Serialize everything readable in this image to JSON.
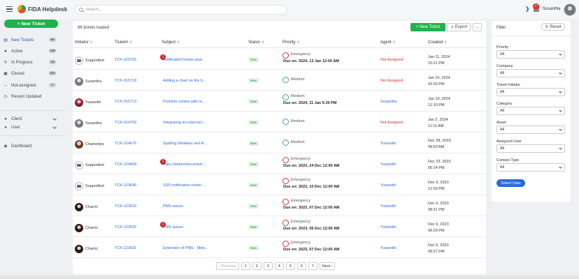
{
  "app": {
    "title": "FIDA Helpdesk"
  },
  "search": {
    "placeholder": "Search..."
  },
  "header": {
    "notification_count": "17",
    "user_name": "Susantha"
  },
  "sidebar": {
    "new_ticket_label": "+ New Ticket",
    "items": [
      {
        "label": "New Tickets",
        "count": "66",
        "icon": "inbox-icon"
      },
      {
        "label": "Active",
        "count": "109",
        "icon": "star-icon"
      },
      {
        "label": "In Progress",
        "count": "43",
        "icon": "refresh-icon"
      },
      {
        "label": "Closed",
        "count": "344",
        "icon": "folder-icon"
      },
      {
        "label": "Not-assigned",
        "count": "7",
        "icon": "minus-icon"
      },
      {
        "label": "Recent Updated",
        "count": "",
        "icon": "clock-icon"
      }
    ],
    "groups": [
      {
        "label": "Client",
        "icon": "person-icon"
      },
      {
        "label": "User",
        "icon": "person-icon"
      }
    ],
    "dashboard_label": "Dashboard"
  },
  "main": {
    "loaded_text": "66 tickets loaded",
    "new_ticket_btn": "+ New Ticket",
    "export_btn": "Export",
    "more_btn": "...",
    "columns": [
      "Initiator",
      "Ticket#",
      "Subject",
      "Status",
      "Priority",
      "Agent",
      "Created"
    ],
    "rows": [
      {
        "initiator": "Supportbot",
        "avatar": "bot",
        "ticket": "TCK-015755",
        "subject": "NotificationCenter.aspx",
        "badge": "1",
        "status": "New",
        "priority": "Emergency",
        "due": "Due on: 2024, 13 Jan 12:00 AM",
        "agent": "Not Assigned",
        "created_date": "Jan 11, 2024",
        "created_time": "10:21 PM"
      },
      {
        "initiator": "Susantha",
        "avatar": "grey",
        "ticket": "TCK-015718",
        "subject": "Adding a chart on the h...",
        "badge": "",
        "status": "New",
        "priority": "Medium",
        "due": "",
        "agent": "Not Assigned",
        "created_date": "Jan 10, 2024",
        "created_time": "03:20 PM"
      },
      {
        "initiator": "Yuwanthi",
        "avatar": "woman2",
        "ticket": "TCK-015713",
        "subject": "Problem comes with re...",
        "badge": "",
        "status": "New",
        "priority": "Medium",
        "due": "Due on: 2024, 11 Jan 5:30 PM",
        "agent": "Susantha",
        "created_date": "Jan 10, 2024",
        "created_time": "12:10 PM"
      },
      {
        "initiator": "Susantha",
        "avatar": "grey",
        "ticket": "TCK-014703",
        "subject": "Integrating an external i...",
        "badge": "",
        "status": "New",
        "priority": "Medium",
        "due": "",
        "agent": "Not Assigned",
        "created_date": "Jan 2, 2024",
        "created_time": "11:11 AM"
      },
      {
        "initiator": "Chamodya",
        "avatar": "person",
        "ticket": "TCK-124676",
        "subject": "Spelling Mistakes and A...",
        "badge": "",
        "status": "New",
        "priority": "Medium",
        "due": "",
        "agent": "Yuwanthi",
        "created_date": "Dec 28, 2023",
        "created_time": "08:53 AM"
      },
      {
        "initiator": "Supportbot",
        "avatar": "bot",
        "ticket": "TCK-124668",
        "subject": "https://abanshira.smart...",
        "badge": "1",
        "status": "New",
        "priority": "Emergency",
        "due": "Due on: 2023, 24 Dec 12:00 AM",
        "agent": "Yuwanthi",
        "created_date": "Dec 23, 2023",
        "created_time": "06:14 PM"
      },
      {
        "initiator": "Supportbot",
        "avatar": "bot",
        "ticket": "TCK-123645",
        "subject": "SSP notification center ...",
        "badge": "",
        "status": "New",
        "priority": "Emergency",
        "due": "Due on: 2023, 10 Dec 12:00 AM",
        "agent": "Yuwanthi",
        "created_date": "Dec 9, 2023",
        "created_time": "12:03 PM"
      },
      {
        "initiator": "Charmi",
        "avatar": "woman",
        "ticket": "TCK-123633",
        "subject": "PMS issues",
        "badge": "",
        "status": "New",
        "priority": "Emergency",
        "due": "Due on: 2023, 07 Dec 12:00 AM",
        "agent": "Yuwanthi",
        "created_date": "Dec 6, 2023",
        "created_time": "08:31 PM"
      },
      {
        "initiator": "Charmi",
        "avatar": "woman",
        "ticket": "TCK-123632",
        "subject": "PMS issues",
        "badge": "1",
        "status": "New",
        "priority": "Emergency",
        "due": "Due on: 2023, 06 Dec 12:00 AM",
        "agent": "Yuwanthi",
        "created_date": "Dec 6, 2023",
        "created_time": "08:29 PM"
      },
      {
        "initiator": "Charmi",
        "avatar": "woman",
        "ticket": "TCK-123631",
        "subject": "Extension of PMS - Midy...",
        "badge": "",
        "status": "New",
        "priority": "Emergency",
        "due": "Due on: 2023, 07 Dec 12:00 AM",
        "agent": "Yuwanthi",
        "created_date": "Dec 6, 2023",
        "created_time": "08:27 PM"
      }
    ],
    "pagination": {
      "prev": "Previous",
      "pages": [
        "1",
        "2",
        "3",
        "4",
        "5",
        "6",
        "7"
      ],
      "next": "Next"
    }
  },
  "filter": {
    "title": "Filter",
    "reset_label": "Reset",
    "fields": [
      {
        "label": "Priority",
        "value": "All"
      },
      {
        "label": "Company",
        "value": "All"
      },
      {
        "label": "Ticket Initiator",
        "value": "All"
      },
      {
        "label": "Category",
        "value": "All"
      },
      {
        "label": "Asset",
        "value": "All"
      },
      {
        "label": "Assigned User",
        "value": "All"
      },
      {
        "label": "Contact Type",
        "value": "All"
      }
    ],
    "date_button": "Select Date"
  },
  "colors": {
    "accent_green": "#22b14c",
    "link_blue": "#2b6ad8",
    "danger_red": "#d33333"
  }
}
